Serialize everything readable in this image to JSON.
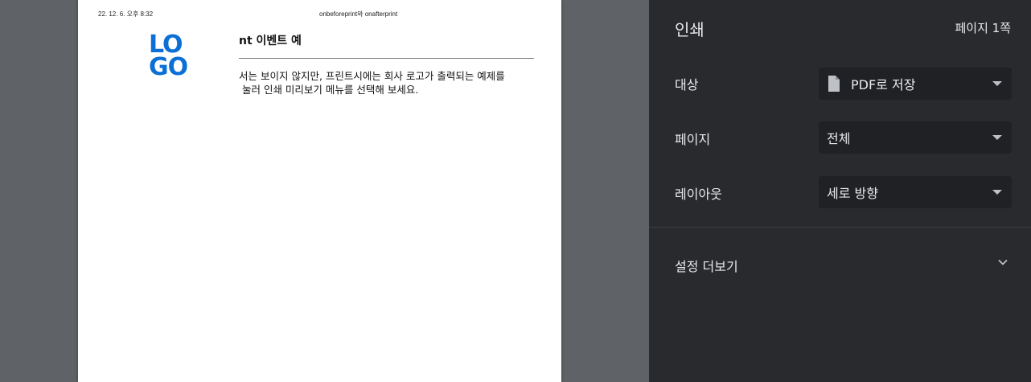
{
  "preview": {
    "header_date": "22. 12. 6. 오후 8:32",
    "header_title": "onbeforeprint와 onafterprint",
    "logo_line1": "LO",
    "logo_line2": "GO",
    "heading": "nt 이벤트 예",
    "paragraph_line1": "서는 보이지 않지만, 프린트시에는 회사 로고가 출력되는 예제를",
    "paragraph_line2": " 눌러 인쇄 미리보기 메뉴를 선택해 보세요."
  },
  "panel": {
    "title": "인쇄",
    "page_count": "페이지 1쪽",
    "destination": {
      "label": "대상",
      "value": "PDF로 저장",
      "icon": "file-icon"
    },
    "pages": {
      "label": "페이지",
      "value": "전체"
    },
    "layout": {
      "label": "레이아웃",
      "value": "세로 방향"
    },
    "more_settings": "설정 더보기"
  },
  "colors": {
    "panel_bg": "#292a2d",
    "select_bg": "#202124",
    "logo_blue": "#0b6fd6"
  }
}
